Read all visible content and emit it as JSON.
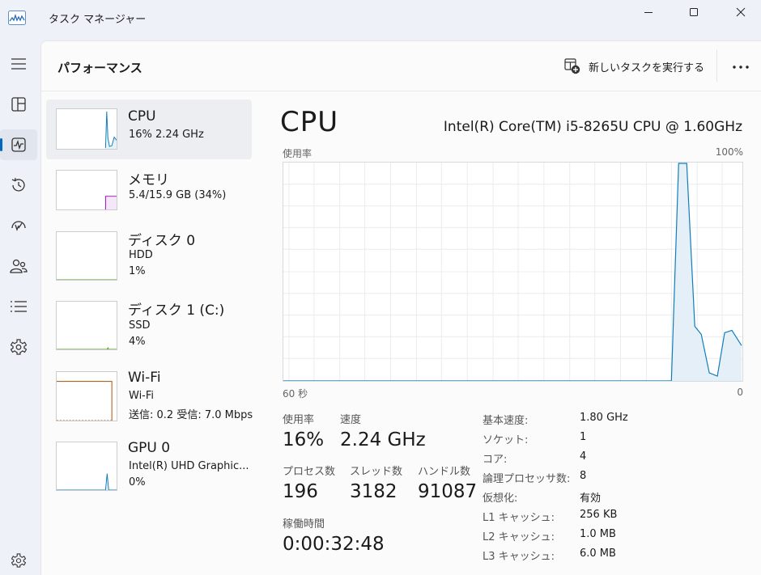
{
  "window": {
    "title": "タスク マネージャー"
  },
  "header": {
    "page_title": "パフォーマンス",
    "new_task_label": "新しいタスクを実行する"
  },
  "devices": [
    {
      "name": "CPU",
      "sub1": "16% 2.24 GHz",
      "sub2": ""
    },
    {
      "name": "メモリ",
      "sub1": "5.4/15.9 GB (34%)",
      "sub2": ""
    },
    {
      "name": "ディスク 0",
      "sub1": "HDD",
      "sub2": "1%"
    },
    {
      "name": "ディスク 1 (C:)",
      "sub1": "SSD",
      "sub2": "4%"
    },
    {
      "name": "Wi-Fi",
      "sub1": "Wi-Fi",
      "sub2": "送信: 0.2 受信: 7.0 Mbps"
    },
    {
      "name": "GPU 0",
      "sub1": "Intel(R) UHD Graphic...",
      "sub2": "0%"
    }
  ],
  "detail": {
    "title": "CPU",
    "model": "Intel(R) Core(TM) i5-8265U CPU @ 1.60GHz",
    "graph_label_top_left": "使用率",
    "graph_label_top_right": "100%",
    "graph_label_bottom_left": "60 秒",
    "graph_label_bottom_right": "0",
    "stats": {
      "usage_label": "使用率",
      "usage_value": "16%",
      "speed_label": "速度",
      "speed_value": "2.24 GHz",
      "processes_label": "プロセス数",
      "processes_value": "196",
      "threads_label": "スレッド数",
      "threads_value": "3182",
      "handles_label": "ハンドル数",
      "handles_value": "91087",
      "uptime_label": "稼働時間",
      "uptime_value": "0:00:32:48"
    },
    "info": [
      {
        "label": "基本速度:",
        "value": "1.80 GHz"
      },
      {
        "label": "ソケット:",
        "value": "1"
      },
      {
        "label": "コア:",
        "value": "4"
      },
      {
        "label": "論理プロセッサ数:",
        "value": "8"
      },
      {
        "label": "仮想化:",
        "value": "有効"
      },
      {
        "label": "L1 キャッシュ:",
        "value": "256 KB"
      },
      {
        "label": "L2 キャッシュ:",
        "value": "1.0 MB"
      },
      {
        "label": "L3 キャッシュ:",
        "value": "6.0 MB"
      }
    ]
  },
  "colors": {
    "cpu_line": "#117dbb",
    "memory_line": "#8b12ae",
    "disk_line": "#4da60c",
    "wifi_line": "#a74f01",
    "accent": "#0067c0"
  },
  "icons": {
    "app": "task-manager-icon",
    "nav": [
      "processes-icon",
      "performance-icon",
      "app-history-icon",
      "startup-apps-icon",
      "users-icon",
      "details-icon",
      "services-icon",
      "settings-icon"
    ],
    "new_task": "new-task-icon",
    "more": "more-options-icon"
  }
}
